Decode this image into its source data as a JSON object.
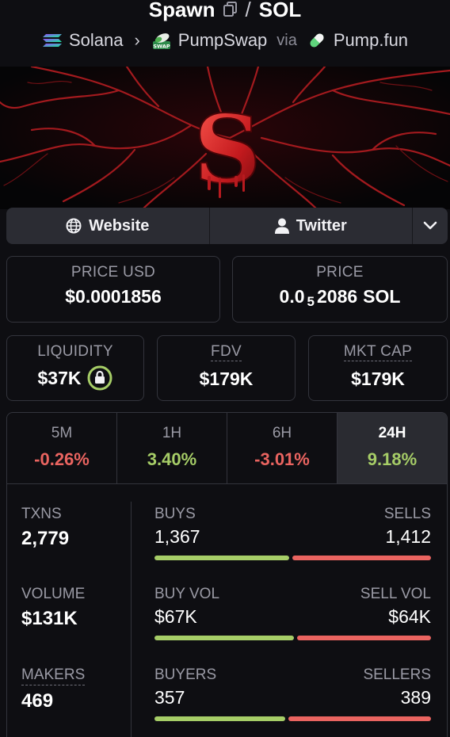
{
  "header": {
    "token": "Spawn",
    "separator": "/",
    "quote": "SOL",
    "chain": "Solana",
    "dex": "PumpSwap",
    "via": "via",
    "launchpad": "Pump.fun",
    "dex_badge": "SWAP"
  },
  "links": {
    "website": "Website",
    "twitter": "Twitter"
  },
  "price": {
    "usd_label": "PRICE USD",
    "usd_value": "$0.0001856",
    "native_label": "PRICE",
    "native_prefix": "0.0",
    "native_zeros": "5",
    "native_digits": "2086",
    "native_unit": "SOL"
  },
  "metrics": {
    "liquidity_label": "LIQUIDITY",
    "liquidity_value": "$37K",
    "fdv_label": "FDV",
    "fdv_value": "$179K",
    "mcap_label": "MKT CAP",
    "mcap_value": "$179K"
  },
  "timeframes": [
    {
      "label": "5M",
      "change": "-0.26%"
    },
    {
      "label": "1H",
      "change": "3.40%"
    },
    {
      "label": "6H",
      "change": "-3.01%"
    },
    {
      "label": "24H",
      "change": "9.18%"
    }
  ],
  "active_timeframe": "24H",
  "stats": {
    "txns_label": "TXNS",
    "txns_value": "2,779",
    "buys_label": "BUYS",
    "buys_value": "1,367",
    "sells_label": "SELLS",
    "sells_value": "1,412",
    "buys_ratio": 0.492,
    "volume_label": "VOLUME",
    "volume_value": "$131K",
    "buyvol_label": "BUY VOL",
    "buyvol_value": "$67K",
    "sellvol_label": "SELL VOL",
    "sellvol_value": "$64K",
    "buyvol_ratio": 0.51,
    "makers_label": "MAKERS",
    "makers_value": "469",
    "buyers_label": "BUYERS",
    "buyers_value": "357",
    "sellers_label": "SELLERS",
    "sellers_value": "389",
    "buyers_ratio": 0.478
  },
  "colors": {
    "positive": "#a6cd67",
    "negative": "#ea6460",
    "panel": "#2b2c33",
    "border": "#33343c"
  },
  "icons": [
    "copy-icon",
    "solana-icon",
    "pumpswap-icon",
    "pumpfun-icon",
    "globe-icon",
    "user-icon",
    "chevron-down-icon",
    "lock-icon"
  ]
}
